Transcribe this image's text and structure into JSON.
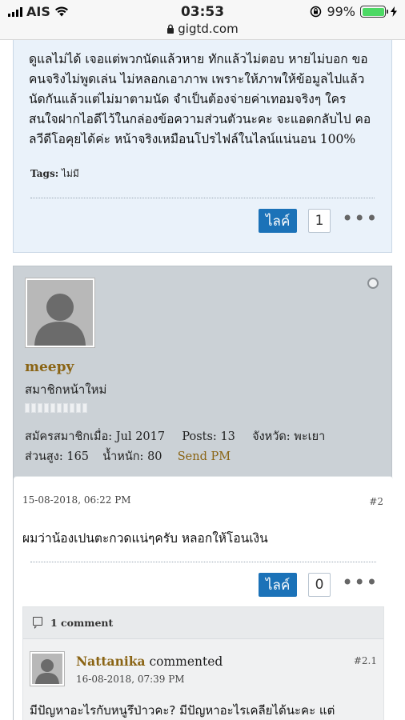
{
  "status_bar": {
    "carrier": "AIS",
    "time": "03:53",
    "url": "gigtd.com",
    "battery": "99%"
  },
  "post1": {
    "lines": [
      "ดูแลไม่ได้ เจอแต่พวกนัดแล้วหาย ทักแล้วไม่ตอบ หายไม่บอก ขอ",
      "คนจริงไม่พูดเล่น ไม่หลอกเอาภาพ เพราะให้ภาพให้ข้อมูลไปแล้ว",
      "นัดกันแล้วแต่ไม่มาตามนัด จำเป็นต้องจ่ายค่าเทอมจริงๆ ใคร",
      "สนใจฝากไอดีไว้ในกล่องข้อความส่วนตัวนะคะ จะแอดกลับไป คอ",
      "ลวีดีโอคุยได้ค่ะ หน้าจริงเหมือนโปรไฟล์ในไลน์แน่นอน 100%"
    ],
    "tags_label": "Tags:",
    "tags_value": "ไม่มี",
    "like_label": "ไลค์",
    "like_count": "1",
    "more": "•••"
  },
  "user": {
    "name": "meepy",
    "rank": "สมาชิกหน้าใหม่",
    "joined_label": "สมัครสมาชิกเมื่อ:",
    "joined_value": "Jul 2017",
    "posts_label": "Posts:",
    "posts_value": "13",
    "province_label": "จังหวัด:",
    "province_value": "พะเยา",
    "height_label": "ส่วนสูง:",
    "height_value": "165",
    "weight_label": "น้ำหนัก:",
    "weight_value": "80",
    "send_pm": "Send PM"
  },
  "post2": {
    "date": "15-08-2018, 06:22 PM",
    "number": "#2",
    "message": "ผมว่าน้องเปนตะกวดแน่ๆครับ หลอกให้โอนเงิน",
    "like_label": "ไลค์",
    "like_count": "0",
    "more": "•••"
  },
  "comments": {
    "header": "1 comment",
    "items": [
      {
        "author": "Nattanika",
        "action": "commented",
        "number": "#2.1",
        "date": "16-08-2018, 07:39 PM",
        "text": "มีปัญหาอะไรกับหนูรึป่าวคะ? มีปัญหาอะไรเคลียได้นะคะ แต่"
      }
    ]
  },
  "colors": {
    "like_button": "#1b72b8",
    "username": "#8a6414",
    "post1_bg": "#eaf2fa",
    "usercard_bg": "#cbd1d6"
  }
}
